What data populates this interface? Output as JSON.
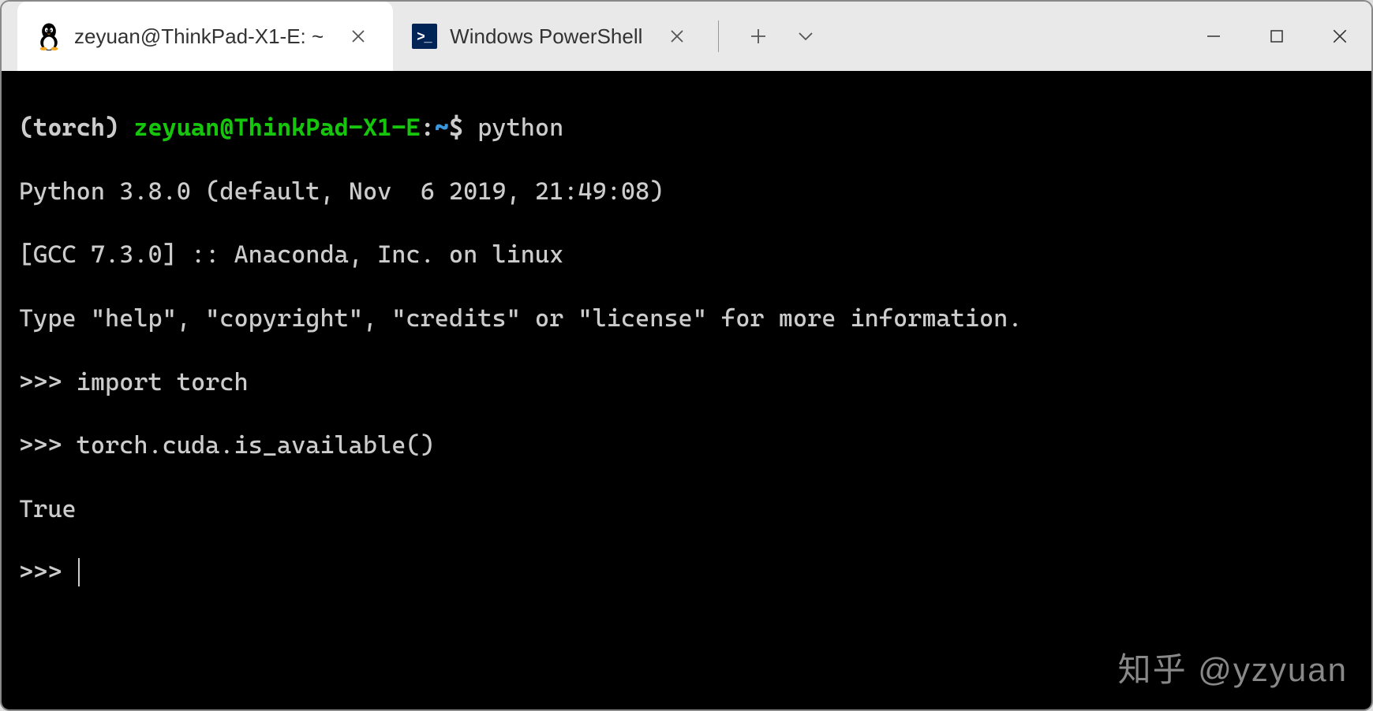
{
  "titlebar": {
    "tabs": [
      {
        "title": "zeyuan@ThinkPad-X1-E: ~",
        "icon": "tux-icon",
        "active": true
      },
      {
        "title": "Windows PowerShell",
        "icon": "powershell-icon",
        "active": false
      }
    ]
  },
  "terminal": {
    "env_prefix": "(torch) ",
    "user_host": "zeyuan@ThinkPad-X1-E",
    "colon": ":",
    "cwd": "~",
    "prompt_suffix": "$ ",
    "command": "python",
    "output_line1": "Python 3.8.0 (default, Nov  6 2019, 21:49:08) ",
    "output_line2": "[GCC 7.3.0] :: Anaconda, Inc. on linux",
    "output_line3": "Type \"help\", \"copyright\", \"credits\" or \"license\" for more information.",
    "repl_prompt": ">>> ",
    "repl_cmd1": "import torch",
    "repl_cmd2": "torch.cuda.is_available()",
    "repl_result": "True",
    "repl_prompt_empty": ">>> "
  },
  "watermark": "知乎 @yzyuan"
}
